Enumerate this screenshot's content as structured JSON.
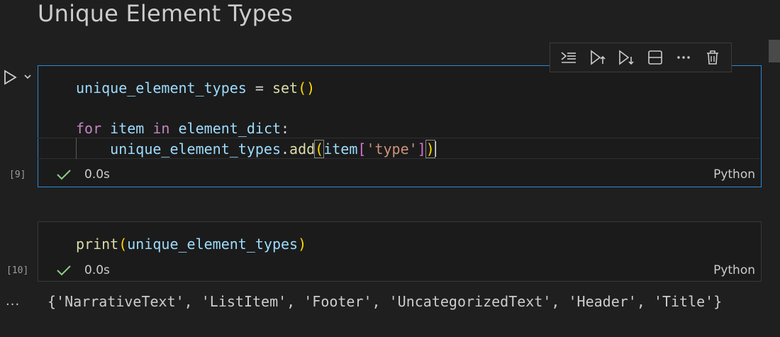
{
  "heading": "Unique Element Types",
  "toolbar": {
    "buttons": [
      {
        "icon": "run-by-line-icon"
      },
      {
        "icon": "execute-above-icon"
      },
      {
        "icon": "execute-below-icon"
      },
      {
        "icon": "split-cell-icon"
      },
      {
        "icon": "more-icon"
      },
      {
        "icon": "delete-icon"
      }
    ]
  },
  "cells": [
    {
      "exec_count": "[9]",
      "code": {
        "l1": {
          "a": "unique_element_types",
          "b": " = ",
          "c": "set",
          "d": "()"
        },
        "l3": {
          "a": "for",
          "b": " ",
          "c": "item",
          "d": " ",
          "e": "in",
          "f": " ",
          "g": "element_dict",
          "h": ":"
        },
        "l4": {
          "indent": "    ",
          "a": "unique_element_types",
          "b": ".",
          "c": "add",
          "d": "(",
          "e": "item",
          "f": "[",
          "g": "'type'",
          "h": "]",
          "i": ")"
        }
      },
      "duration": "0.0s",
      "language": "Python",
      "status_color": "#89d185"
    },
    {
      "exec_count": "[10]",
      "code": {
        "l1": {
          "a": "print",
          "b": "(",
          "c": "unique_element_types",
          "d": ")"
        }
      },
      "duration": "0.0s",
      "language": "Python",
      "status_color": "#89d185"
    }
  ],
  "output": {
    "ellipsis": "...",
    "text": "{'NarrativeText', 'ListItem', 'Footer', 'UncategorizedText', 'Header', 'Title'}"
  },
  "colors": {
    "background": "#1f1f1f",
    "focus_border": "#2a89d6",
    "success": "#89d185"
  }
}
